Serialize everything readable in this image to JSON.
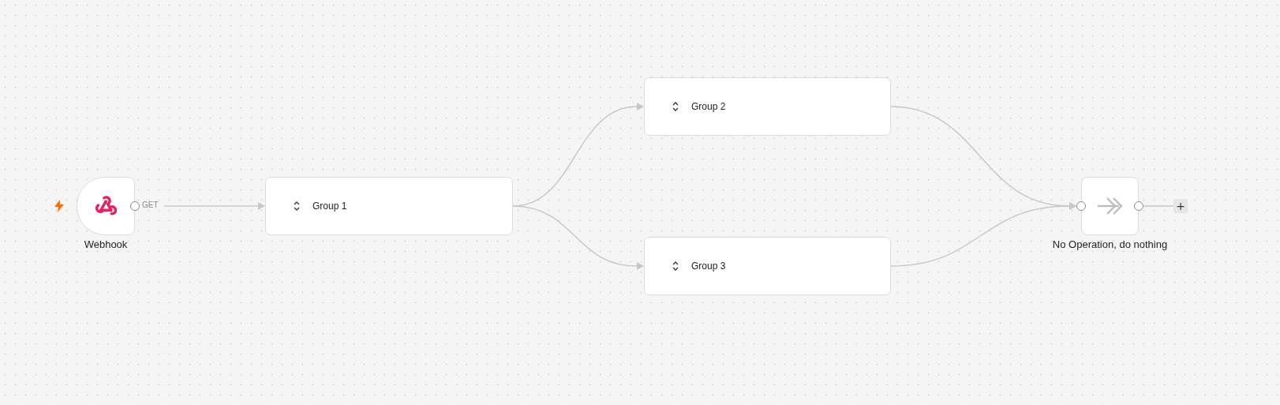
{
  "nodes": [
    {
      "kind": "webhook",
      "label": "Webhook",
      "trigger": true,
      "output_label": "GET"
    },
    {
      "kind": "group",
      "label": "Group 1"
    },
    {
      "kind": "group",
      "label": "Group 2"
    },
    {
      "kind": "group",
      "label": "Group 3"
    },
    {
      "kind": "noop",
      "label": "No Operation, do nothing",
      "add_label": "+"
    }
  ]
}
